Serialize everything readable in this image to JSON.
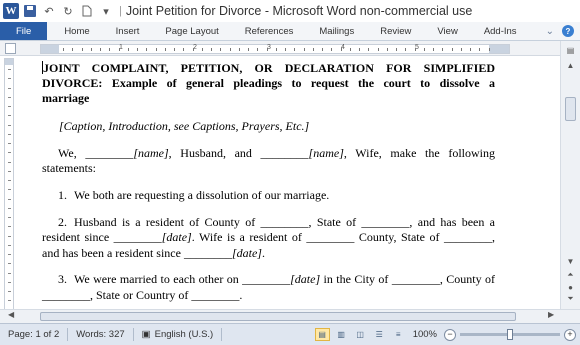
{
  "window": {
    "title": "Joint Petition for Divorce",
    "app_title": "Microsoft Word non-commercial use",
    "separator": "-"
  },
  "quick_access": {
    "icons": [
      "word-icon",
      "save-icon",
      "undo-icon",
      "redo-icon",
      "new-document-icon"
    ]
  },
  "ribbon": {
    "tabs": [
      "File",
      "Home",
      "Insert",
      "Page Layout",
      "References",
      "Mailings",
      "Review",
      "View",
      "Add-Ins"
    ]
  },
  "ruler": {
    "numbers": [
      "1",
      "2",
      "3",
      "4",
      "5"
    ]
  },
  "document": {
    "heading_line1": "JOINT COMPLAINT, PETITION, OR DECLARATION FOR SIMPLIFIED",
    "heading_line2": "DIVORCE: Example of general pleadings to request the court to dissolve a",
    "heading_line3": "marriage",
    "caption": "[Caption, Introduction, see Captions, Prayers, Etc.]",
    "intro": {
      "we": "We, ________",
      "name1": "[name]",
      "husband": ", Husband, and ________",
      "name2": "[name]",
      "rest": ", Wife, make the following statements:"
    },
    "items": [
      {
        "num": "1.",
        "text": "We both are requesting a dissolution of our marriage."
      },
      {
        "num": "2.",
        "a": "Husband is a resident of County of ________, State of ________, and has been a resident since ________",
        "date1": "[date]",
        "b": ". Wife is a resident of ________ County, State of ________, and has been a resident since ________",
        "date2": "[date]",
        "c": "."
      },
      {
        "num": "3.",
        "a": "We were married to each other on ________",
        "date": "[date]",
        "b": " in the City of ________, County of ________, State or Country of ________."
      }
    ]
  },
  "status": {
    "page": "Page: 1 of 2",
    "words": "Words: 327",
    "language": "English (U.S.)",
    "zoom": "100%",
    "zoom_level": 100
  },
  "colors": {
    "file_tab": "#2a5ea8",
    "status_bar": "#dfe6f0",
    "active_view": "#ffe8a6"
  }
}
